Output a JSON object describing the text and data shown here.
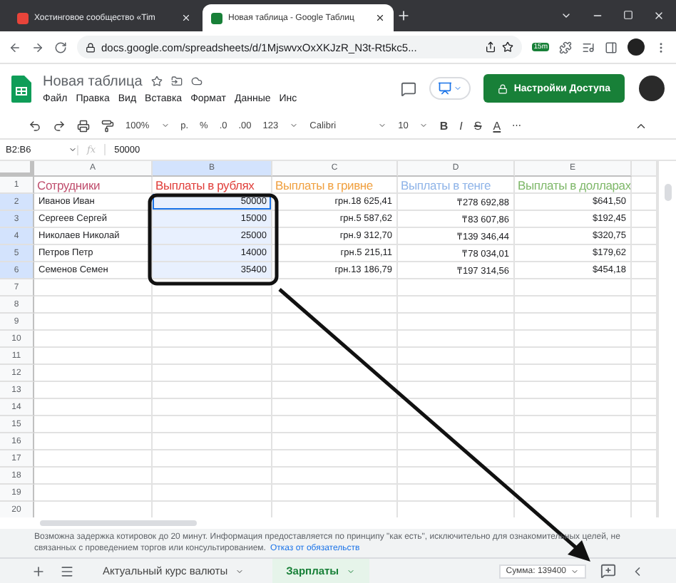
{
  "browser": {
    "tabs": [
      {
        "title": "Хостинговое сообщество «Tim",
        "selected": false
      },
      {
        "title": "Новая таблица - Google Таблиц",
        "selected": true
      }
    ],
    "url": "docs.google.com/spreadsheets/d/1MjswvxOxXKJzR_N3t-Rt5kc5...",
    "extension_badge": "15m"
  },
  "document": {
    "title": "Новая таблица",
    "menu": [
      "Файл",
      "Правка",
      "Вид",
      "Вставка",
      "Формат",
      "Данные",
      "Инс"
    ],
    "share_button": "Настройки Доступа"
  },
  "toolbar": {
    "zoom": "100%",
    "currency": "р.",
    "percent": "%",
    "decrease_decimals": ".0",
    "increase_decimals": ".00",
    "number_format": "123",
    "font": "Calibri",
    "font_size": "10",
    "bold": "B",
    "italic": "I",
    "strike": "S",
    "text_color": "A",
    "more": "⋯"
  },
  "formula_bar": {
    "range": "B2:B6",
    "fx_label": "fx",
    "value": "50000"
  },
  "columns": [
    {
      "letter": "A",
      "kind": "text",
      "selected": false
    },
    {
      "letter": "B",
      "kind": "number",
      "selected": true
    },
    {
      "letter": "C",
      "kind": "number",
      "selected": false
    },
    {
      "letter": "D",
      "kind": "number",
      "selected": false
    },
    {
      "letter": "E",
      "kind": "number",
      "selected": false
    }
  ],
  "header_row": {
    "number": "1",
    "cells": [
      {
        "text": "Сотрудники",
        "color": "#c0506f"
      },
      {
        "text": "Выплаты в рублях",
        "color": "#e0403c"
      },
      {
        "text": "Выплаты в гривне",
        "color": "#f0a040"
      },
      {
        "text": "Выплаты в тенге",
        "color": "#8fb4e8"
      },
      {
        "text": "Выплаты в долларах",
        "color": "#7fb86a"
      }
    ]
  },
  "rows": [
    {
      "number": "2",
      "selected": true,
      "cells": [
        {
          "text": "Иванов Иван",
          "selected": false
        },
        {
          "text": "50000",
          "selected": true
        },
        {
          "text": "грн.18 625,41",
          "selected": false
        },
        {
          "text": "₸278 692,88",
          "selected": false
        },
        {
          "text": "$641,50",
          "selected": false
        }
      ]
    },
    {
      "number": "3",
      "selected": true,
      "cells": [
        {
          "text": "Сергеев Сергей",
          "selected": false
        },
        {
          "text": "15000",
          "selected": true
        },
        {
          "text": "грн.5 587,62",
          "selected": false
        },
        {
          "text": "₸83 607,86",
          "selected": false
        },
        {
          "text": "$192,45",
          "selected": false
        }
      ]
    },
    {
      "number": "4",
      "selected": true,
      "cells": [
        {
          "text": "Николаев Николай",
          "selected": false
        },
        {
          "text": "25000",
          "selected": true
        },
        {
          "text": "грн.9 312,70",
          "selected": false
        },
        {
          "text": "₸139 346,44",
          "selected": false
        },
        {
          "text": "$320,75",
          "selected": false
        }
      ]
    },
    {
      "number": "5",
      "selected": true,
      "cells": [
        {
          "text": "Петров Петр",
          "selected": false
        },
        {
          "text": "14000",
          "selected": true
        },
        {
          "text": "грн.5 215,11",
          "selected": false
        },
        {
          "text": "₸78 034,01",
          "selected": false
        },
        {
          "text": "$179,62",
          "selected": false
        }
      ]
    },
    {
      "number": "6",
      "selected": true,
      "cells": [
        {
          "text": "Семенов Семен",
          "selected": false
        },
        {
          "text": "35400",
          "selected": true
        },
        {
          "text": "грн.13 186,79",
          "selected": false
        },
        {
          "text": "₸197 314,56",
          "selected": false
        },
        {
          "text": "$454,18",
          "selected": false
        }
      ]
    }
  ],
  "empty_rows": [
    "7",
    "8",
    "9",
    "10",
    "11",
    "12",
    "13",
    "14",
    "15",
    "16",
    "17",
    "18",
    "19",
    "20"
  ],
  "notice": {
    "text": "Возможна задержка котировок до 20 минут. Информация предоставляется по принципу \"как есть\", исключительно для ознакомительных целей, не связанных с проведением торгов или консультированием.",
    "link": "Отказ от обязательств"
  },
  "sheet_tabs": [
    {
      "name": "Актуальный курс валюты",
      "selected": false
    },
    {
      "name": "Зарплаты",
      "selected": true
    }
  ],
  "sum": "Сумма: 139400"
}
